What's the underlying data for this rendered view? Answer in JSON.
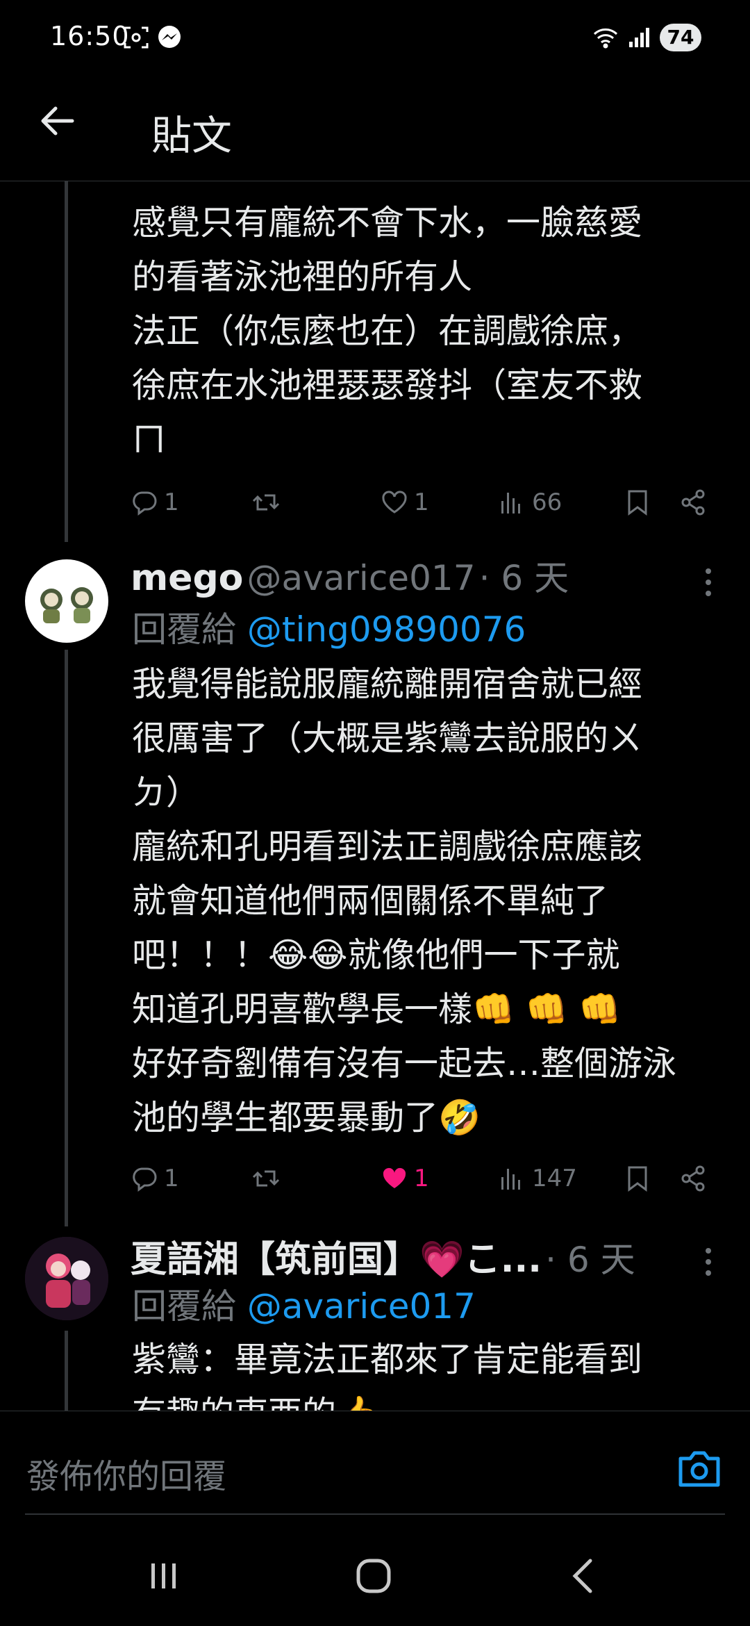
{
  "status_bar": {
    "time": "16:50",
    "battery": "74"
  },
  "header": {
    "title": "貼文"
  },
  "tweets": [
    {
      "body": "感覺只有龐統不會下水，一臉慈愛\n的看著泳池裡的所有人\n法正（你怎麼也在）在調戲徐庶，\n徐庶在水池裡瑟瑟發抖（室友不救\nㄇ",
      "replies": "1",
      "likes": "1",
      "views": "66"
    },
    {
      "name": "mego",
      "handle": "@avarice017",
      "time": "· 6 天",
      "reply_prefix": "回覆給 ",
      "reply_to": "@ting09890076",
      "body": "我覺得能說服龐統離開宿舍就已經\n很厲害了（大概是紫鸞去說服的ㄨ\nㄉ）\n龐統和孔明看到法正調戲徐庶應該\n就會知道他們兩個關係不單純了\n吧！！！😂😂就像他們一下子就\n知道孔明喜歡學長一樣👊 👊 👊\n好好奇劉備有沒有一起去…整個游泳\n池的學生都要暴動了🤣",
      "replies": "1",
      "likes": "1",
      "views": "147",
      "liked": true
    },
    {
      "name": "夏語湘【筑前国】💗こ...",
      "handle": "",
      "time": "· 6 天",
      "reply_prefix": "回覆給 ",
      "reply_to": "@avarice017",
      "body": "紫鸞：畢竟法正都來了肯定能看到\n有趣的東西的👍"
    }
  ],
  "composer": {
    "placeholder": "發佈你的回覆"
  },
  "colors": {
    "accent": "#1d9bf0",
    "like": "#f91880",
    "muted": "#71767b"
  },
  "icons": [
    "back-arrow-icon",
    "reply-icon",
    "retweet-icon",
    "heart-icon",
    "views-icon",
    "bookmark-icon",
    "share-icon",
    "more-icon",
    "camera-icon"
  ]
}
